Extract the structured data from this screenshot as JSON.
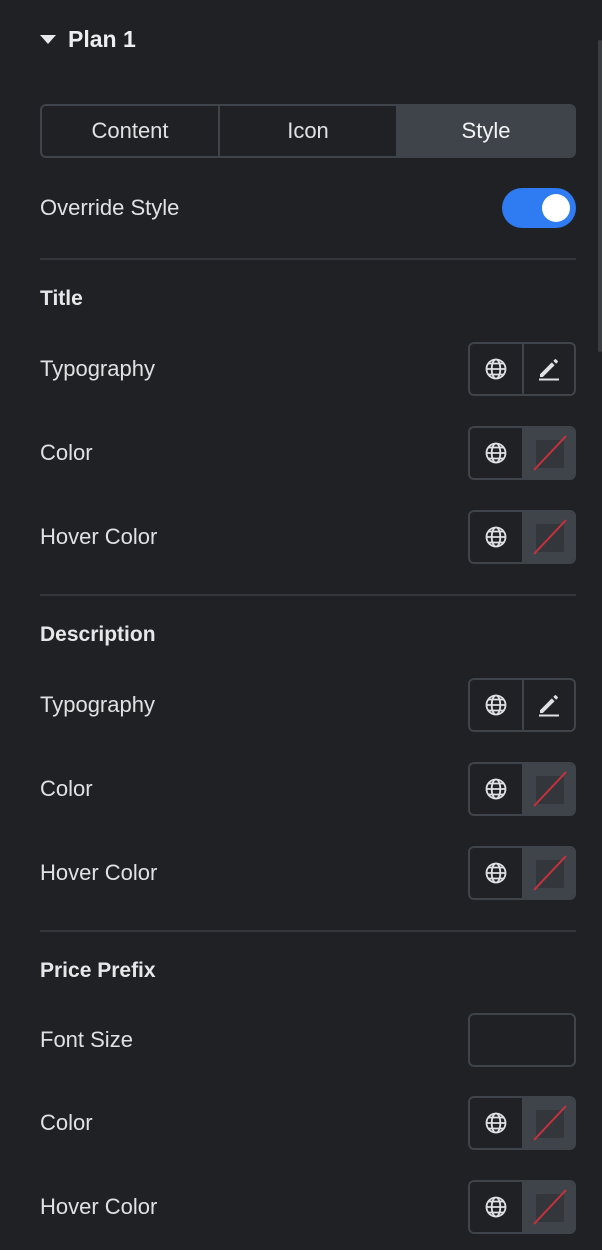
{
  "section": {
    "title": "Plan 1"
  },
  "tabs": [
    {
      "label": "Content",
      "active": false
    },
    {
      "label": "Icon",
      "active": false
    },
    {
      "label": "Style",
      "active": true
    }
  ],
  "override": {
    "label": "Override Style",
    "enabled": true
  },
  "title_group": {
    "heading": "Title",
    "typography": "Typography",
    "color": "Color",
    "hover_color": "Hover Color"
  },
  "description_group": {
    "heading": "Description",
    "typography": "Typography",
    "color": "Color",
    "hover_color": "Hover Color"
  },
  "price_prefix_group": {
    "heading": "Price Prefix",
    "font_size": "Font Size",
    "font_size_value": "",
    "color": "Color",
    "hover_color": "Hover Color"
  },
  "colors": {
    "background": "#1f2124",
    "toggle_on": "#2f7bf2",
    "active_tab": "#3f444b",
    "border": "#3f434a",
    "unset_slash": "#c8323c"
  },
  "icons": {
    "collapse": "caret-down-icon",
    "global": "globe-icon",
    "edit": "pencil-icon",
    "unset_color": "no-color-swatch-icon"
  }
}
